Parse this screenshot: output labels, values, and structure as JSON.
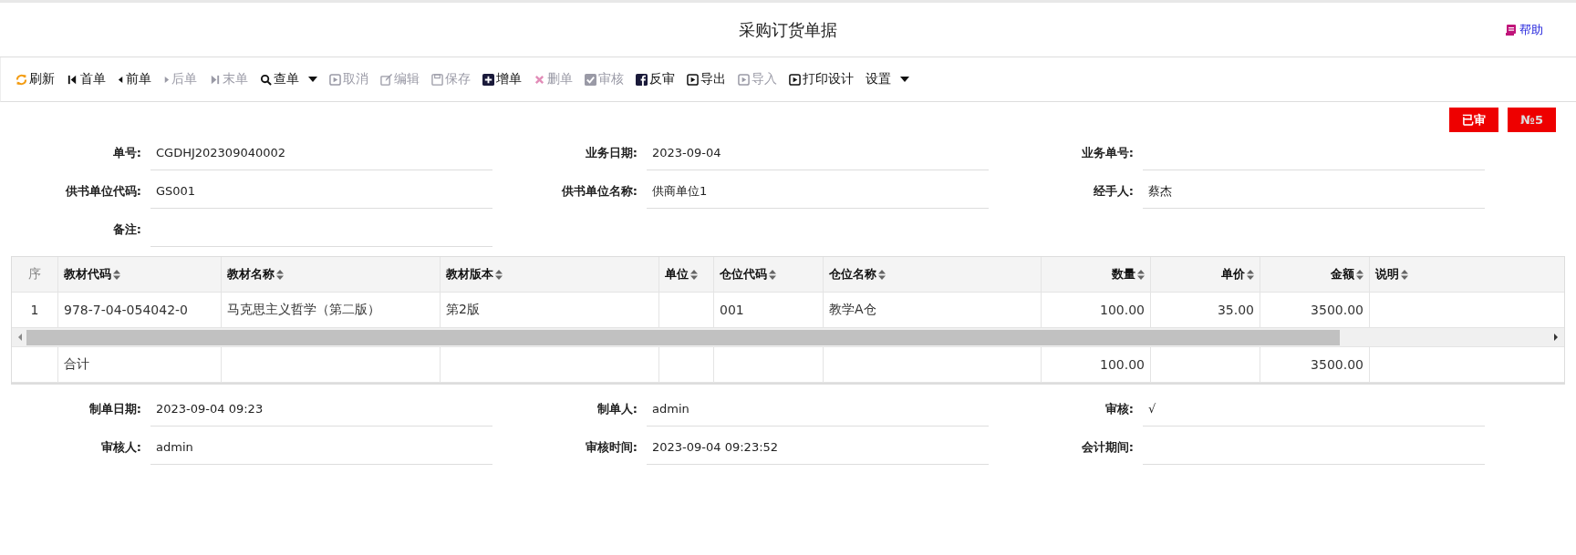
{
  "header": {
    "title": "采购订货单据",
    "help": "帮助"
  },
  "toolbar": [
    {
      "label": "刷新",
      "kind": "refresh",
      "disabled": false
    },
    {
      "label": "首单",
      "kind": "first",
      "disabled": false
    },
    {
      "label": "前单",
      "kind": "prev",
      "disabled": false
    },
    {
      "label": "后单",
      "kind": "next",
      "disabled": true
    },
    {
      "label": "末单",
      "kind": "last",
      "disabled": true
    },
    {
      "label": "查单",
      "kind": "search",
      "disabled": false,
      "dropdown": true
    },
    {
      "label": "取消",
      "kind": "play",
      "disabled": true
    },
    {
      "label": "编辑",
      "kind": "edit",
      "disabled": true
    },
    {
      "label": "保存",
      "kind": "save",
      "disabled": true
    },
    {
      "label": "增单",
      "kind": "plus",
      "disabled": false
    },
    {
      "label": "删单",
      "kind": "cross",
      "disabled": true
    },
    {
      "label": "审核",
      "kind": "check",
      "disabled": true
    },
    {
      "label": "反审",
      "kind": "fsquare",
      "disabled": false
    },
    {
      "label": "导出",
      "kind": "play",
      "disabled": false
    },
    {
      "label": "导入",
      "kind": "play",
      "disabled": true
    },
    {
      "label": "打印设计",
      "kind": "play",
      "disabled": false
    },
    {
      "label": "设置",
      "kind": "text",
      "disabled": false,
      "dropdown": true
    }
  ],
  "badges": [
    "已审",
    "№5"
  ],
  "form": [
    {
      "label": "单号:",
      "value": "CGDHJ202309040002"
    },
    {
      "label": "业务日期:",
      "value": "2023-09-04"
    },
    {
      "label": "业务单号:"
    },
    {
      "label": "供书单位代码:",
      "value": "GS001"
    },
    {
      "label": "供书单位名称:",
      "value": "供商单位1"
    },
    {
      "label": "经手人:",
      "value": "蔡杰"
    },
    {
      "label": "备注:"
    }
  ],
  "table": {
    "seq_header": "序",
    "columns": [
      "教材代码",
      "教材名称",
      "教材版本",
      "单位",
      "仓位代码",
      "仓位名称",
      "数量",
      "单价",
      "金额",
      "说明"
    ],
    "rows": [
      {
        "seq": "1",
        "cells": [
          "978-7-04-054042-0",
          "马克思主义哲学（第二版）",
          "第2版",
          null,
          "001",
          "教学A仓",
          "100.00",
          "35.00",
          "3500.00",
          null
        ]
      }
    ],
    "footer": {
      "label": "合计",
      "quantity": "100.00",
      "amount": "3500.00"
    }
  },
  "footer_form": [
    {
      "label": "制单日期:",
      "value": "2023-09-04 09:23"
    },
    {
      "label": "制单人:",
      "value": "admin"
    },
    {
      "label": "审核:",
      "value": "√"
    },
    {
      "label": "审核人:",
      "value": "admin"
    },
    {
      "label": "审核时间:",
      "value": "2023-09-04 09:23:52"
    },
    {
      "label": "会计期间:"
    }
  ]
}
